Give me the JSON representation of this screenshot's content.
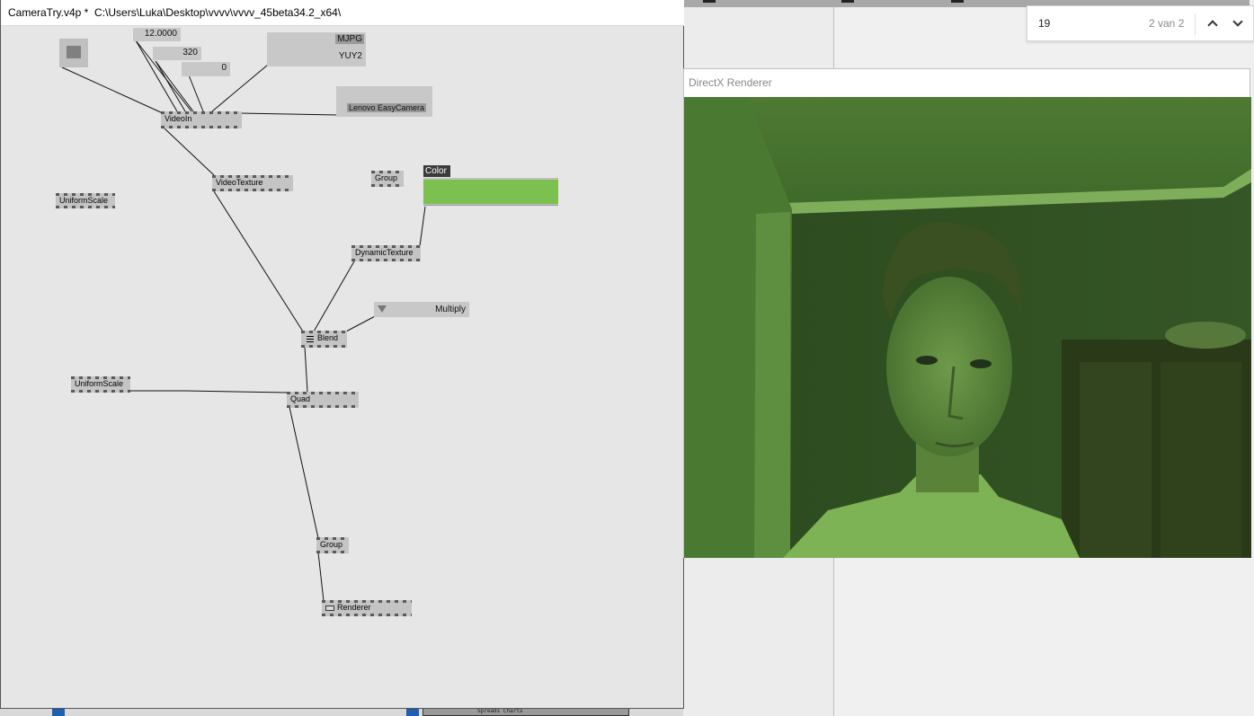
{
  "patch": {
    "title": "CameraTry.v4p *  C:\\Users\\Luka\\Desktop\\vvvv\\vvvv_45beta34.2_x64\\",
    "values": {
      "fps": "12.0000",
      "width": "320",
      "zero": "0",
      "format_a": "MJPG",
      "format_b": "YUY2",
      "device": "Lenovo EasyCamera",
      "blend_mode": "Multiply",
      "color_label": "Color"
    },
    "nodes": {
      "videoin": "VideoIn",
      "videotexture": "VideoTexture",
      "group1": "Group",
      "uniformscale1": "UniformScale",
      "dynamictexture": "DynamicTexture",
      "blend": "Blend",
      "uniformscale2": "UniformScale",
      "quad": "Quad",
      "group2": "Group",
      "renderer": "Renderer"
    },
    "color_value": "#7cc050"
  },
  "renderer": {
    "title": "DirectX Renderer"
  },
  "findbar": {
    "query": "19",
    "count": "2 van 2"
  },
  "background": {
    "strip_text": "Spreads Charts"
  }
}
